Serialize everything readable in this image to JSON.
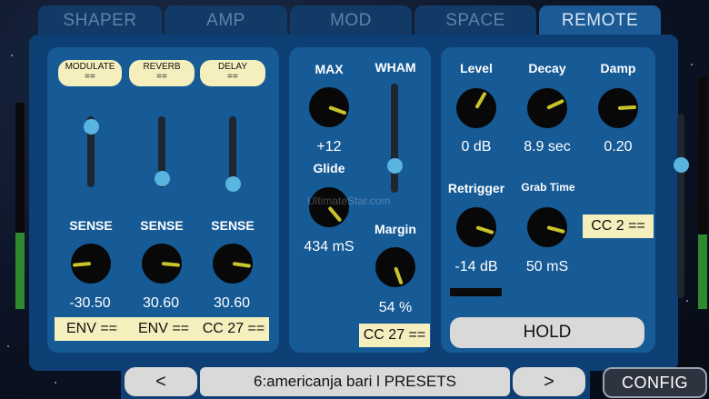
{
  "tabs": [
    {
      "label": "SHAPER",
      "active": false
    },
    {
      "label": "AMP",
      "active": false
    },
    {
      "label": "MOD",
      "active": false
    },
    {
      "label": "SPACE",
      "active": false
    },
    {
      "label": "REMOTE",
      "active": true
    }
  ],
  "left": {
    "buttons": [
      {
        "name": "MODULATE",
        "sub": "=="
      },
      {
        "name": "REVERB",
        "sub": "=="
      },
      {
        "name": "DELAY",
        "sub": "=="
      }
    ],
    "sliders": [
      0.85,
      0.12,
      0.04
    ],
    "sense_labels": [
      "SENSE",
      "SENSE",
      "SENSE"
    ],
    "knobs": [
      {
        "value": "-30.50",
        "angle": 185
      },
      {
        "value": "30.60",
        "angle": -5
      },
      {
        "value": "30.60",
        "angle": -8
      }
    ],
    "assign": [
      "ENV ==",
      "ENV ==",
      "CC 27 =="
    ]
  },
  "middle": {
    "max_label": "MAX",
    "max_value": "+12",
    "max_angle": -20,
    "glide_label": "Glide",
    "glide_value": "434 mS",
    "glide_angle": -50,
    "wham_label": "WHAM",
    "wham_position": 0.25,
    "margin_label": "Margin",
    "margin_value": "54 %",
    "margin_angle": -70,
    "assign": "CC 27 =="
  },
  "remote": {
    "knobs": [
      {
        "label": "Level",
        "value": "0 dB",
        "angle": 60
      },
      {
        "label": "Decay",
        "value": "8.9 sec",
        "angle": 25
      },
      {
        "label": "Damp",
        "value": "0.20",
        "angle": 3
      }
    ],
    "retrigger": {
      "label": "Retrigger",
      "value": "-14 dB",
      "angle": -18
    },
    "grab": {
      "label": "Grab Time",
      "value": "50 mS",
      "angle": -15
    },
    "assign": "CC 2 ==",
    "hold_label": "HOLD"
  },
  "left_meter_level": 0.37,
  "right_meter_level": 0.32,
  "right_slider_position": 0.72,
  "bottom": {
    "prev": "<",
    "preset": "6:americanja bari l  PRESETS",
    "next": ">",
    "config": "CONFIG"
  },
  "watermark": "UltimateStar.com"
}
